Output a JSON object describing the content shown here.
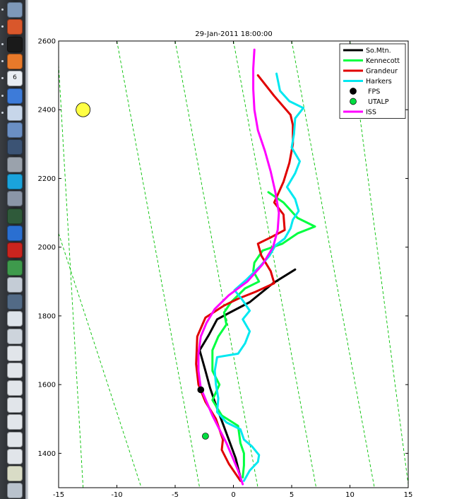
{
  "dock": {
    "icons": [
      {
        "name": "finder-icon",
        "color": "#7e98b8"
      },
      {
        "name": "matlab-icon",
        "color": "#d9572b"
      },
      {
        "name": "terminal-icon",
        "color": "#1a1a1a"
      },
      {
        "name": "firefox-icon",
        "color": "#e8792a"
      },
      {
        "name": "calendar-icon",
        "color": "#e9eef4",
        "day": "6"
      },
      {
        "name": "itunes-icon",
        "color": "#3d7bd9"
      },
      {
        "name": "stickies-icon",
        "color": "#c7d6ea"
      },
      {
        "name": "dashboard-icon",
        "color": "#6a8fc4"
      },
      {
        "name": "idv-icon",
        "color": "#3b5374"
      },
      {
        "name": "system-prefs-icon",
        "color": "#9aa2ac"
      },
      {
        "name": "skype-icon",
        "color": "#1aa3dc"
      },
      {
        "name": "cyberduck-icon",
        "color": "#8b96a8"
      },
      {
        "name": "activity-monitor-icon",
        "color": "#2f5a3a"
      },
      {
        "name": "word-icon",
        "color": "#2a6fd1"
      },
      {
        "name": "acrobat-icon",
        "color": "#c9241e"
      },
      {
        "name": "spaces-icon",
        "color": "#3e9a4c"
      },
      {
        "name": "preview-icon",
        "color": "#c4ccd6"
      },
      {
        "name": "photo-booth-icon",
        "color": "#526a86"
      },
      {
        "name": "textedit-icon",
        "color": "#dde3ea"
      },
      {
        "name": "document-icon-1",
        "color": "#cdd4dc"
      },
      {
        "name": "document-icon-2",
        "color": "#e1e5ea"
      },
      {
        "name": "document-icon-3",
        "color": "#e1e5ea"
      },
      {
        "name": "document-icon-4",
        "color": "#e1e5ea"
      },
      {
        "name": "document-icon-5",
        "color": "#e1e5ea"
      },
      {
        "name": "document-icon-6",
        "color": "#e1e5ea"
      },
      {
        "name": "document-icon-7",
        "color": "#e1e5ea"
      },
      {
        "name": "document-icon-8",
        "color": "#e1e5ea"
      },
      {
        "name": "graph-thumbnail-icon",
        "color": "#d9dcc6"
      },
      {
        "name": "weather-icon",
        "color": "#b9c2cc"
      }
    ]
  },
  "chart_data": {
    "type": "line",
    "title": "29-Jan-2011 18:00:00",
    "xlim": [
      -15,
      15
    ],
    "ylim": [
      1300,
      2600
    ],
    "xticks": [
      -15,
      -10,
      -5,
      0,
      5,
      10,
      15
    ],
    "yticks": [
      1400,
      1600,
      1800,
      2000,
      2200,
      2400,
      2600
    ],
    "grid": false,
    "legend_position": "top-right",
    "reference_lines": {
      "style": "dashed",
      "color": "#00c000",
      "lines": [
        [
          [
            -15,
            2530
          ],
          [
            -12.9,
            1300
          ]
        ],
        [
          [
            -15,
            2040
          ],
          [
            -7.9,
            1300
          ]
        ],
        [
          [
            -10,
            2600
          ],
          [
            -2.9,
            1300
          ]
        ],
        [
          [
            -5,
            2600
          ],
          [
            2.1,
            1300
          ]
        ],
        [
          [
            0,
            2600
          ],
          [
            7.1,
            1300
          ]
        ],
        [
          [
            5,
            2600
          ],
          [
            12.1,
            1300
          ]
        ],
        [
          [
            10,
            2600
          ],
          [
            15,
            1310
          ]
        ]
      ]
    },
    "series": [
      {
        "name": "So.Mtn.",
        "color": "#000000",
        "kind": "line",
        "points": [
          [
            5.3,
            1935
          ],
          [
            3.4,
            1895
          ],
          [
            1.4,
            1840
          ],
          [
            -0.4,
            1808
          ],
          [
            -1.4,
            1790
          ],
          [
            -2.1,
            1745
          ],
          [
            -2.9,
            1700
          ],
          [
            -2.4,
            1640
          ],
          [
            -2.0,
            1590
          ],
          [
            -1.5,
            1540
          ],
          [
            -1.0,
            1495
          ],
          [
            -0.4,
            1440
          ],
          [
            0.2,
            1385
          ],
          [
            0.6,
            1330
          ]
        ]
      },
      {
        "name": "Kennecott",
        "color": "#00ff40",
        "kind": "line",
        "points": [
          [
            3.0,
            2160
          ],
          [
            4.3,
            2130
          ],
          [
            5.5,
            2085
          ],
          [
            7.0,
            2060
          ],
          [
            5.5,
            2040
          ],
          [
            4.2,
            2010
          ],
          [
            2.5,
            1990
          ],
          [
            1.8,
            1955
          ],
          [
            1.7,
            1930
          ],
          [
            2.2,
            1900
          ],
          [
            1.0,
            1880
          ],
          [
            -0.2,
            1840
          ],
          [
            -0.8,
            1810
          ],
          [
            -0.6,
            1775
          ],
          [
            -1.3,
            1740
          ],
          [
            -1.8,
            1700
          ],
          [
            -1.8,
            1640
          ],
          [
            -1.2,
            1600
          ],
          [
            -1.8,
            1555
          ],
          [
            -1.0,
            1510
          ],
          [
            0.4,
            1480
          ],
          [
            0.6,
            1430
          ],
          [
            0.9,
            1400
          ],
          [
            0.9,
            1365
          ],
          [
            0.8,
            1330
          ]
        ]
      },
      {
        "name": "Grandeur",
        "color": "#e00000",
        "kind": "line",
        "points": [
          [
            2.1,
            2500
          ],
          [
            3.5,
            2440
          ],
          [
            4.9,
            2385
          ],
          [
            5.1,
            2355
          ],
          [
            5.1,
            2300
          ],
          [
            4.8,
            2245
          ],
          [
            4.3,
            2190
          ],
          [
            3.5,
            2130
          ],
          [
            4.3,
            2095
          ],
          [
            4.4,
            2050
          ],
          [
            3.3,
            2030
          ],
          [
            2.1,
            2010
          ],
          [
            2.4,
            1975
          ],
          [
            3.2,
            1930
          ],
          [
            3.5,
            1895
          ],
          [
            1.9,
            1870
          ],
          [
            0.4,
            1850
          ],
          [
            -0.8,
            1830
          ],
          [
            -2.4,
            1795
          ],
          [
            -3.1,
            1740
          ],
          [
            -3.2,
            1660
          ],
          [
            -3.0,
            1600
          ],
          [
            -2.4,
            1550
          ],
          [
            -1.5,
            1500
          ],
          [
            -0.9,
            1440
          ],
          [
            -1.0,
            1410
          ],
          [
            -0.4,
            1370
          ],
          [
            0.6,
            1320
          ]
        ]
      },
      {
        "name": "Harkers",
        "color": "#00e8f0",
        "kind": "line",
        "points": [
          [
            3.7,
            2505
          ],
          [
            4.0,
            2455
          ],
          [
            4.8,
            2425
          ],
          [
            6.0,
            2405
          ],
          [
            5.3,
            2375
          ],
          [
            5.2,
            2330
          ],
          [
            5.0,
            2290
          ],
          [
            5.7,
            2250
          ],
          [
            5.3,
            2215
          ],
          [
            4.6,
            2175
          ],
          [
            5.3,
            2140
          ],
          [
            5.6,
            2105
          ],
          [
            5.1,
            2080
          ],
          [
            4.9,
            2055
          ],
          [
            4.4,
            2025
          ],
          [
            3.6,
            2005
          ],
          [
            3.1,
            1975
          ],
          [
            2.3,
            1945
          ],
          [
            1.1,
            1905
          ],
          [
            0.1,
            1875
          ],
          [
            0.8,
            1845
          ],
          [
            1.4,
            1815
          ],
          [
            0.8,
            1790
          ],
          [
            1.4,
            1755
          ],
          [
            1.0,
            1720
          ],
          [
            0.4,
            1690
          ],
          [
            -1.4,
            1680
          ],
          [
            -1.6,
            1640
          ],
          [
            -1.5,
            1600
          ],
          [
            -1.3,
            1560
          ],
          [
            -1.4,
            1520
          ],
          [
            -0.6,
            1490
          ],
          [
            0.6,
            1470
          ],
          [
            0.9,
            1440
          ],
          [
            1.6,
            1420
          ],
          [
            2.2,
            1395
          ],
          [
            2.1,
            1375
          ],
          [
            1.4,
            1350
          ],
          [
            0.9,
            1320
          ]
        ]
      },
      {
        "name": "FPS",
        "color": "#000000",
        "kind": "marker",
        "points": [
          [
            -2.8,
            1585
          ]
        ]
      },
      {
        "name": "UTALP",
        "color": "#00dd40",
        "kind": "marker",
        "points": [
          [
            -2.4,
            1450
          ]
        ]
      },
      {
        "name": "ISS",
        "color": "#ff00ff",
        "kind": "line",
        "points": [
          [
            1.8,
            2575
          ],
          [
            1.7,
            2520
          ],
          [
            1.7,
            2460
          ],
          [
            1.8,
            2400
          ],
          [
            2.1,
            2340
          ],
          [
            2.7,
            2280
          ],
          [
            3.2,
            2220
          ],
          [
            3.6,
            2160
          ],
          [
            3.9,
            2100
          ],
          [
            3.8,
            2050
          ],
          [
            3.4,
            2000
          ],
          [
            2.5,
            1950
          ],
          [
            1.2,
            1900
          ],
          [
            -0.4,
            1860
          ],
          [
            -1.6,
            1820
          ],
          [
            -2.3,
            1780
          ],
          [
            -2.8,
            1740
          ],
          [
            -3.0,
            1690
          ],
          [
            -3.0,
            1640
          ],
          [
            -2.8,
            1590
          ],
          [
            -2.3,
            1550
          ],
          [
            -1.8,
            1510
          ],
          [
            -1.2,
            1470
          ],
          [
            -0.6,
            1430
          ],
          [
            -0.1,
            1390
          ],
          [
            0.4,
            1350
          ],
          [
            0.8,
            1310
          ]
        ]
      }
    ],
    "sun": {
      "x": -12.9,
      "y": 2400,
      "color": "#ffff44"
    }
  }
}
